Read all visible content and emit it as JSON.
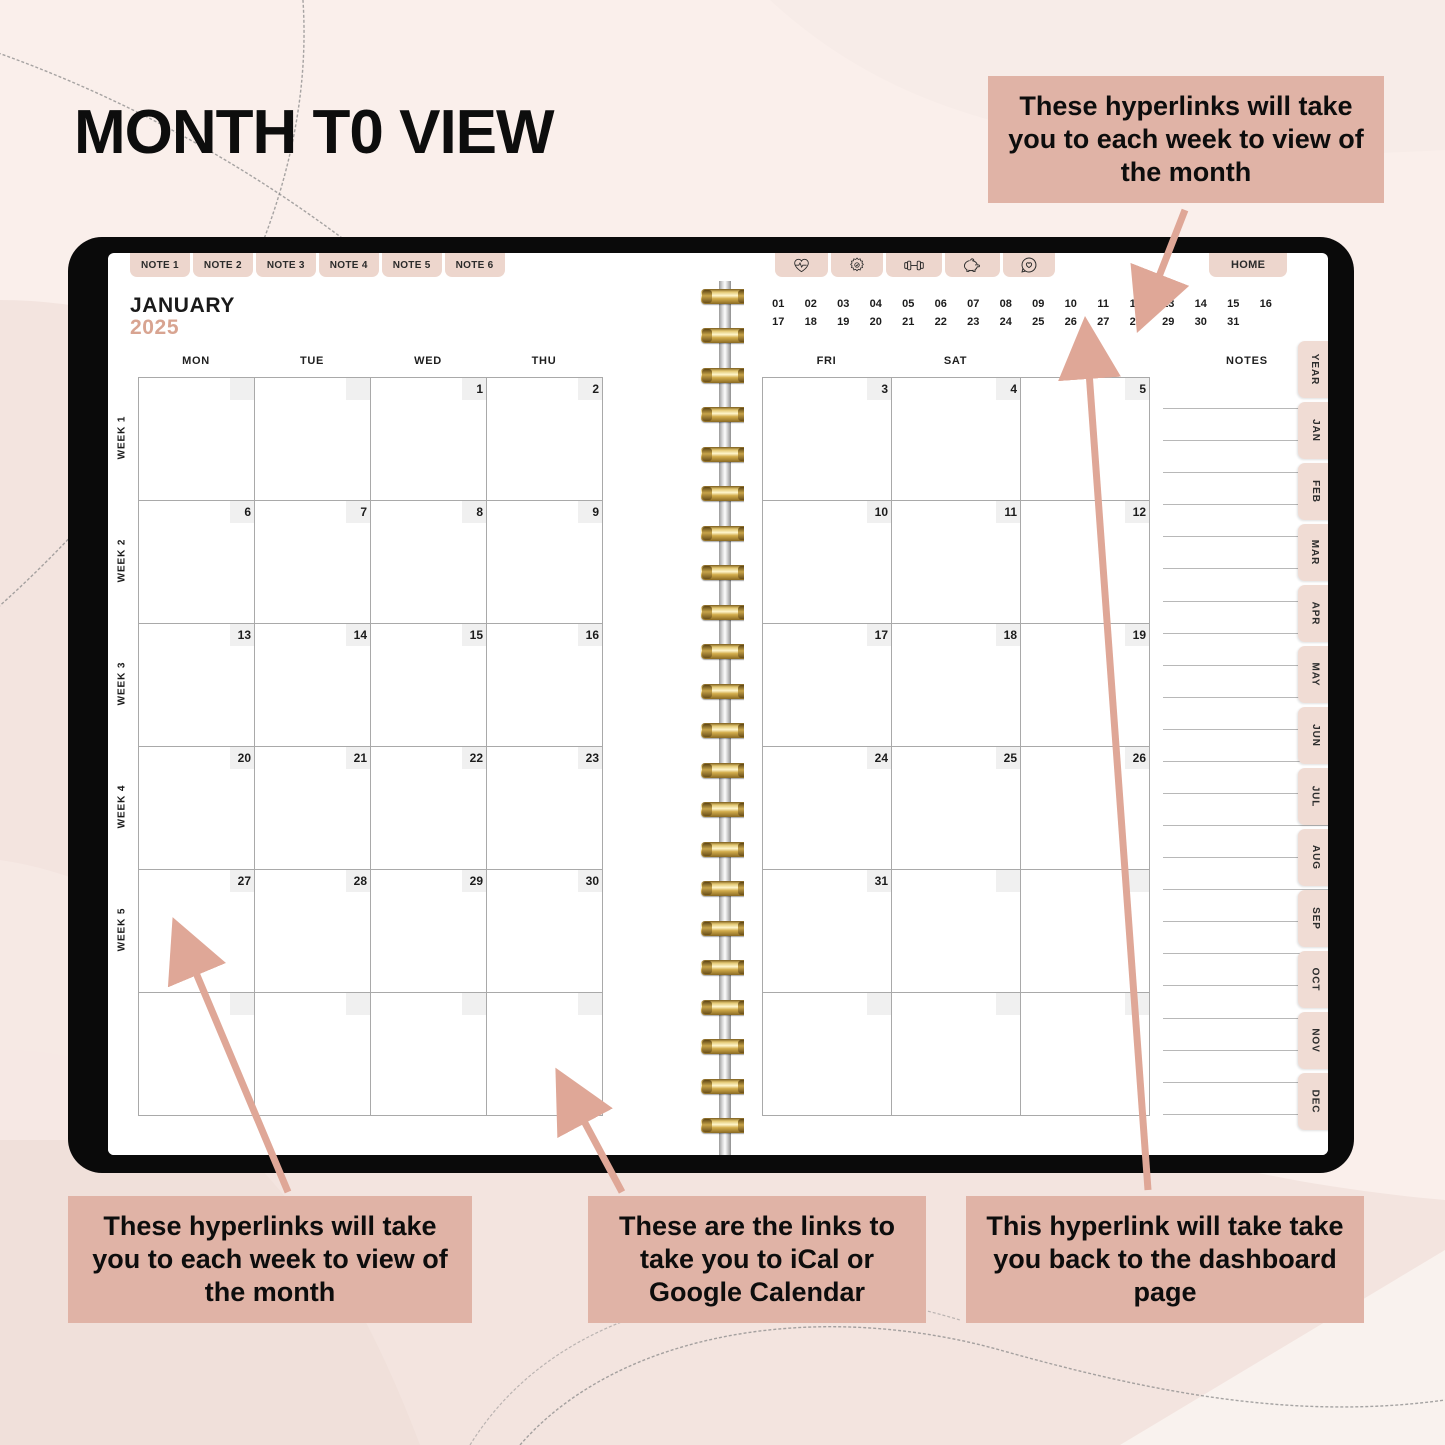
{
  "page_title": "MONTH T0 VIEW",
  "colors": {
    "background": "#faefeb",
    "tab": "#edd6cd",
    "side_tab": "#f0dcd4",
    "callout": "#e0b3a6",
    "accent_year": "#d8a491",
    "arrow": "#dfa797",
    "device": "#0a0a0a"
  },
  "planner": {
    "note_tabs": [
      "NOTE 1",
      "NOTE 2",
      "NOTE 3",
      "NOTE 4",
      "NOTE 5",
      "NOTE 6"
    ],
    "icon_tabs": [
      {
        "name": "heart-pulse-icon"
      },
      {
        "name": "flower-icon"
      },
      {
        "name": "dumbbell-icon"
      },
      {
        "name": "piggy-bank-icon"
      },
      {
        "name": "chat-heart-icon"
      }
    ],
    "home_tab": "HOME",
    "month": "JANUARY",
    "year": "2025",
    "weekday_headers_left": [
      "MON",
      "TUE",
      "WED",
      "THU"
    ],
    "weekday_headers_right": [
      "FRI",
      "SAT",
      "SUN"
    ],
    "week_labels": [
      "WEEK 1",
      "WEEK 2",
      "WEEK 3",
      "WEEK 4",
      "WEEK 5"
    ],
    "grid_left": [
      [
        "",
        "",
        "1",
        "2"
      ],
      [
        "6",
        "7",
        "8",
        "9"
      ],
      [
        "13",
        "14",
        "15",
        "16"
      ],
      [
        "20",
        "21",
        "22",
        "23"
      ],
      [
        "27",
        "28",
        "29",
        "30"
      ],
      [
        "",
        "",
        "",
        ""
      ]
    ],
    "grid_right": [
      [
        "3",
        "4",
        "5"
      ],
      [
        "10",
        "11",
        "12"
      ],
      [
        "17",
        "18",
        "19"
      ],
      [
        "24",
        "25",
        "26"
      ],
      [
        "31",
        "",
        ""
      ],
      [
        "",
        "",
        ""
      ]
    ],
    "day_links_row1": [
      "01",
      "02",
      "03",
      "04",
      "05",
      "06",
      "07",
      "08",
      "09",
      "10",
      "11",
      "12",
      "13",
      "14",
      "15",
      "16"
    ],
    "day_links_row2": [
      "17",
      "18",
      "19",
      "20",
      "21",
      "22",
      "23",
      "24",
      "25",
      "26",
      "27",
      "28",
      "29",
      "30",
      "31"
    ],
    "notes_title": "NOTES",
    "notes_line_count": 23,
    "side_tabs": [
      "YEAR",
      "JAN",
      "FEB",
      "MAR",
      "APR",
      "MAY",
      "JUN",
      "JUL",
      "AUG",
      "SEP",
      "OCT",
      "NOV",
      "DEC"
    ]
  },
  "callouts": {
    "top_right": "These hyperlinks will take you to each week to view of the month",
    "bottom_left": "These hyperlinks will take you to each week to view of the month",
    "bottom_center": "These are the links to take you to iCal or Google Calendar",
    "bottom_right": "This hyperlink will take take you back to the dashboard page"
  }
}
